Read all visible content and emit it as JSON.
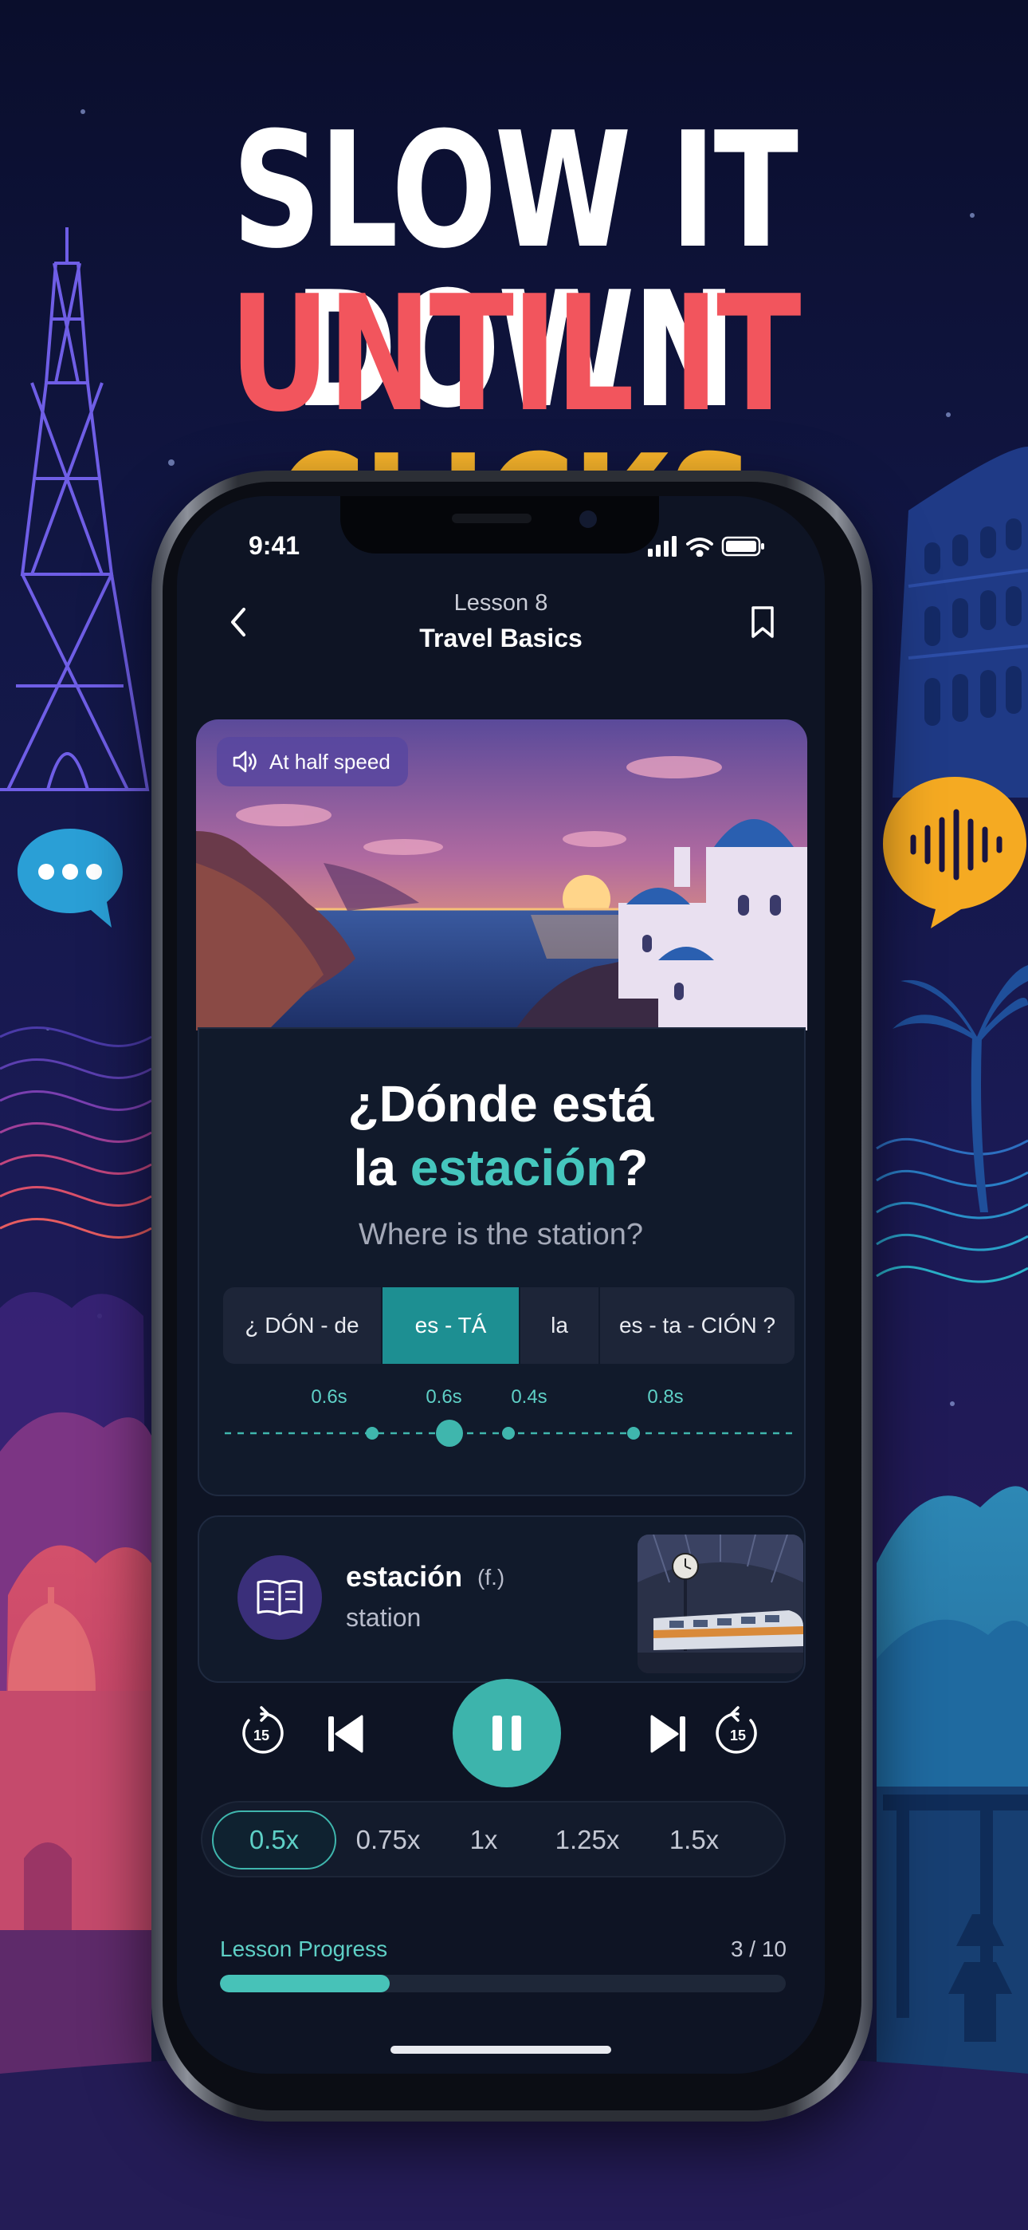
{
  "headline": {
    "line1": "SLOW IT DOWN",
    "line2_red": "UNTIL IT ",
    "line2_yellow": "CLICKS"
  },
  "status_bar": {
    "time": "9:41"
  },
  "nav": {
    "lesson_number": "Lesson 8",
    "lesson_title": "Travel Basics"
  },
  "hero": {
    "badge": "At half speed"
  },
  "phrase": {
    "line1": "¿Dónde está",
    "line2_prefix": "la ",
    "line2_highlight": "estación",
    "line2_suffix": "?",
    "translation": "Where is the station?"
  },
  "syllables": [
    {
      "text": "¿ DÓN - de",
      "duration": "0.6s"
    },
    {
      "text": "es - TÁ",
      "duration": "0.6s",
      "active": true
    },
    {
      "text": "la",
      "duration": "0.4s"
    },
    {
      "text": "es - ta - CIÓN ?",
      "duration": "0.8s"
    }
  ],
  "vocab": {
    "word": "estación",
    "gender": "(f.)",
    "translation": "station"
  },
  "controls": {
    "rewind_seconds": "15",
    "forward_seconds": "15"
  },
  "speeds": {
    "options": [
      "0.5x",
      "0.75x",
      "1x",
      "1.25x",
      "1.5x"
    ],
    "selected": "0.5x"
  },
  "progress": {
    "label": "Lesson Progress",
    "count": "3 / 10",
    "current": 3,
    "total": 10
  },
  "colors": {
    "accent_teal": "#45c6bd",
    "headline_red": "#f2555d",
    "headline_yellow": "#f8b42b",
    "badge_purple": "#5846a0"
  }
}
